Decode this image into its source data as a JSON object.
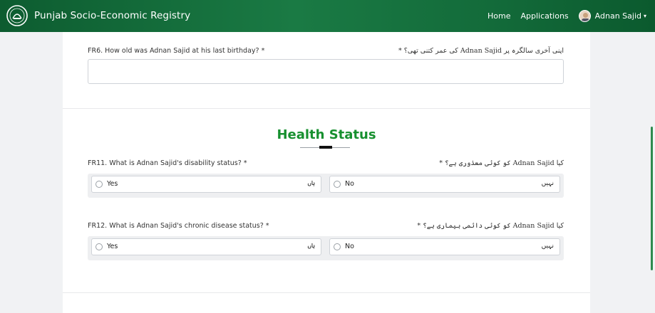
{
  "navbar": {
    "brand": "Punjab Socio-Economic Registry",
    "links": [
      "Home",
      "Applications"
    ],
    "user_name": "Adnan Sajid",
    "caret": "▾"
  },
  "questions": {
    "fr6": {
      "label_en": "FR6. How old was Adnan Sajid at his last birthday?",
      "required": "*",
      "label_ur": "اپنی آخری سالگرہ پر Adnan Sajid کی عمر کتنی تھی؟ *",
      "input_value": ""
    },
    "fr11": {
      "label_en": "FR11. What is Adnan Sajid's disability status?",
      "required": "*",
      "label_ur": "کیا Adnan Sajid کو کوئی معذوری ہے؟ *",
      "options": [
        {
          "en": "Yes",
          "ur": "ہاں"
        },
        {
          "en": "No",
          "ur": "نہیں"
        }
      ]
    },
    "fr12": {
      "label_en": "FR12. What is Adnan Sajid's chronic disease status?",
      "required": "*",
      "label_ur": "کیا Adnan Sajid کو کوئی دائمی بیماری ہے؟ *",
      "options": [
        {
          "en": "Yes",
          "ur": "ہاں"
        },
        {
          "en": "No",
          "ur": "نہیں"
        }
      ]
    }
  },
  "section": {
    "title": "Health Status"
  },
  "colors": {
    "brand_green": "#17902f",
    "navbar_green": "#1a7a44",
    "required_red": "#d33"
  }
}
